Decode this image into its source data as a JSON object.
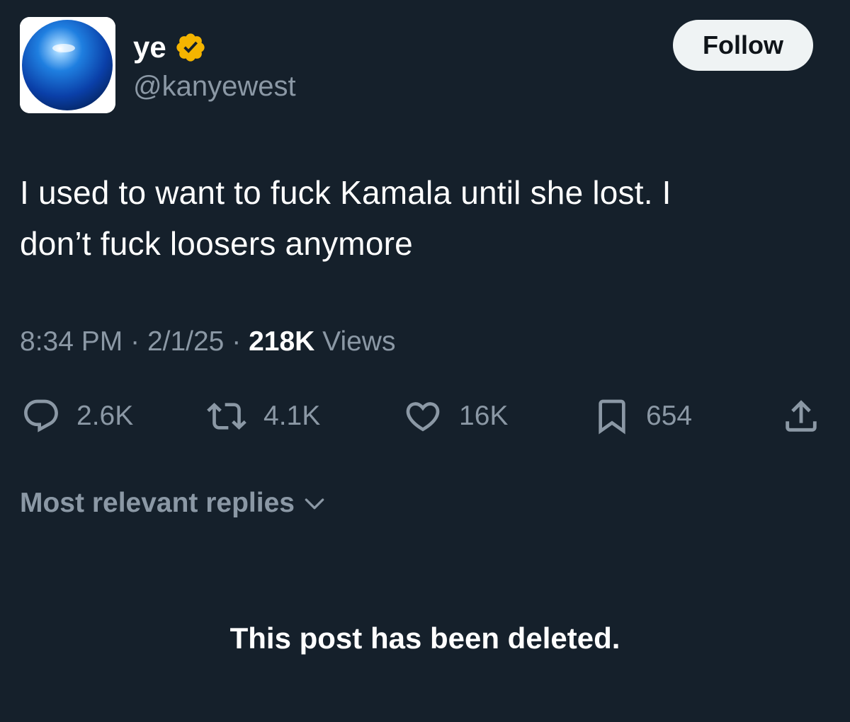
{
  "author": {
    "display_name": "ye",
    "handle": "@kanyewest",
    "verified_icon": "verified-badge-icon",
    "verified_color": "#f4b400"
  },
  "follow_button": {
    "label": "Follow"
  },
  "post": {
    "text": "I used to want to fuck Kamala until she lost. I\ndon’t fuck loosers anymore",
    "time": "8:34 PM",
    "separator": "·",
    "date": "2/1/25",
    "views_count": "218K",
    "views_label": "Views"
  },
  "actions": {
    "replies": {
      "icon": "reply-icon",
      "count": "2.6K"
    },
    "reposts": {
      "icon": "repost-icon",
      "count": "4.1K"
    },
    "likes": {
      "icon": "heart-icon",
      "count": "16K"
    },
    "bookmarks": {
      "icon": "bookmark-icon",
      "count": "654"
    },
    "share": {
      "icon": "share-icon"
    }
  },
  "replies_sort": {
    "label": "Most relevant replies",
    "icon": "chevron-down-icon"
  },
  "deleted_notice": "This post has been deleted.",
  "colors": {
    "background": "#15202b",
    "text_primary": "#ffffff",
    "text_secondary": "#8b98a5",
    "follow_button_bg": "#eff3f4"
  }
}
